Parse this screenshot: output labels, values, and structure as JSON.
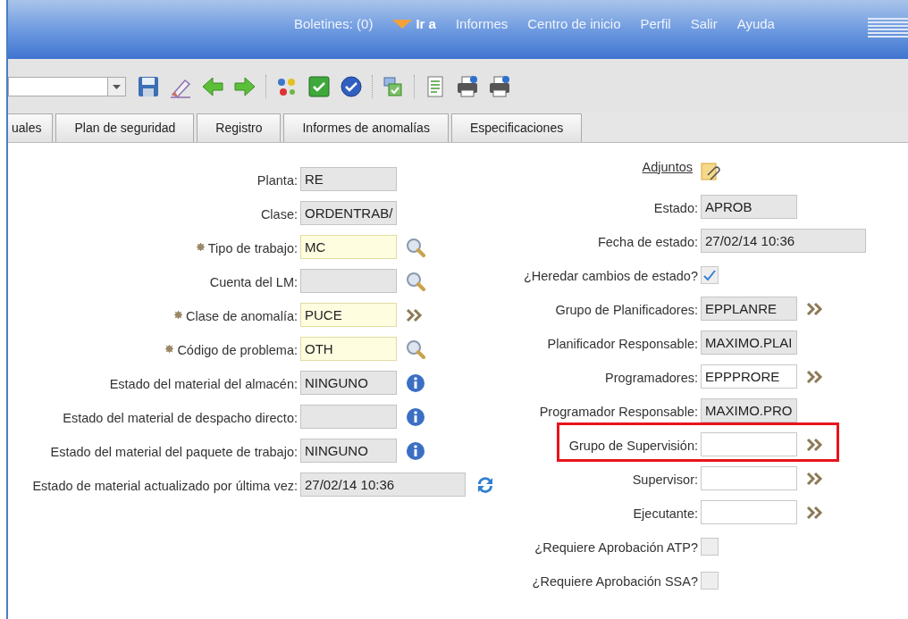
{
  "header": {
    "links": [
      {
        "label": "Boletines: (0)",
        "kind": "link"
      },
      {
        "label": "Ir a",
        "kind": "goto"
      },
      {
        "label": "Informes",
        "kind": "link"
      },
      {
        "label": "Centro de inicio",
        "kind": "link"
      },
      {
        "label": "Perfil",
        "kind": "link"
      },
      {
        "label": "Salir",
        "kind": "link"
      },
      {
        "label": "Ayuda",
        "kind": "link"
      }
    ]
  },
  "toolbar": {
    "tools": [
      {
        "kind": "save"
      },
      {
        "kind": "eraser"
      },
      {
        "kind": "back"
      },
      {
        "kind": "forward"
      },
      {
        "kind": "sep"
      },
      {
        "kind": "dots"
      },
      {
        "kind": "check-square"
      },
      {
        "kind": "check-circle"
      },
      {
        "kind": "sep"
      },
      {
        "kind": "stack"
      },
      {
        "kind": "sep"
      },
      {
        "kind": "list"
      },
      {
        "kind": "print"
      },
      {
        "kind": "print"
      }
    ]
  },
  "tabs": [
    {
      "label": "uales",
      "selected": false
    },
    {
      "label": "Plan de seguridad",
      "selected": false
    },
    {
      "label": "Registro",
      "selected": false
    },
    {
      "label": "Informes de anomalías",
      "selected": false
    },
    {
      "label": "Especificaciones",
      "selected": false
    }
  ],
  "left_fields": [
    {
      "label": "Planta:",
      "kind": "readonly",
      "value": "RE",
      "required": false
    },
    {
      "label": "Clase:",
      "kind": "readonly",
      "value": "ORDENTRAB/",
      "required": false
    },
    {
      "label": "Tipo de trabajo:",
      "kind": "input",
      "value": "MC",
      "required": true,
      "action": {
        "kind": "lookup"
      }
    },
    {
      "label": "Cuenta del LM:",
      "kind": "readonly",
      "required": false,
      "action": {
        "kind": "lookup"
      }
    },
    {
      "label": "Clase de anomalía:",
      "kind": "input",
      "value": "PUCE",
      "required": true,
      "action": {
        "kind": "more"
      }
    },
    {
      "label": "Código de problema:",
      "kind": "input",
      "value": "OTH",
      "required": true,
      "action": {
        "kind": "lookup"
      }
    },
    {
      "label": "Estado del material del almacén:",
      "kind": "readonly",
      "value": "NINGUNO",
      "required": false,
      "action": {
        "kind": "info"
      }
    },
    {
      "label": "Estado del material de despacho directo:",
      "kind": "readonly",
      "required": false,
      "action": {
        "kind": "info"
      }
    },
    {
      "label": "Estado del material del paquete de trabajo:",
      "kind": "readonly",
      "value": "NINGUNO",
      "required": false,
      "action": {
        "kind": "info"
      }
    },
    {
      "label": "Estado de material actualizado por última vez:",
      "kind": "readonly-wide",
      "value": "27/02/14 10:36",
      "required": false,
      "action": {
        "kind": "refresh"
      }
    }
  ],
  "right_fields": [
    {
      "label": "Adjuntos",
      "kind": "link",
      "action": {
        "kind": "attach"
      },
      "highlighted": false
    },
    {
      "label": "Estado:",
      "kind": "readonly",
      "value": "APROB",
      "highlighted": false
    },
    {
      "label": "Fecha de estado:",
      "kind": "readonly-wide",
      "value": "27/02/14 10:36",
      "highlighted": false
    },
    {
      "label": "¿Heredar cambios de estado?",
      "kind": "checkbox",
      "checked": true,
      "highlighted": false
    },
    {
      "label": "Grupo de Planificadores:",
      "kind": "readonly",
      "value": "EPPLANRE",
      "action": {
        "kind": "more"
      },
      "highlighted": false
    },
    {
      "label": "Planificador Responsable:",
      "kind": "readonly",
      "value": "MAXIMO.PLAI",
      "highlighted": false
    },
    {
      "label": "Programadores:",
      "kind": "editable",
      "value": "EPPPRORE",
      "action": {
        "kind": "more"
      },
      "highlighted": false
    },
    {
      "label": "Programador Responsable:",
      "kind": "readonly",
      "value": "MAXIMO.PRO",
      "highlighted": false
    },
    {
      "label": "Grupo de Supervisión:",
      "kind": "editable",
      "action": {
        "kind": "more"
      },
      "highlighted": true
    },
    {
      "label": "Supervisor:",
      "kind": "editable",
      "action": {
        "kind": "more"
      },
      "highlighted": false
    },
    {
      "label": "Ejecutante:",
      "kind": "editable",
      "action": {
        "kind": "more"
      },
      "highlighted": false
    },
    {
      "label": "¿Requiere Aprobación ATP?",
      "kind": "checkbox",
      "checked": false,
      "highlighted": false
    },
    {
      "label": "¿Requiere Aprobación SSA?",
      "kind": "checkbox",
      "checked": false,
      "highlighted": false
    }
  ]
}
